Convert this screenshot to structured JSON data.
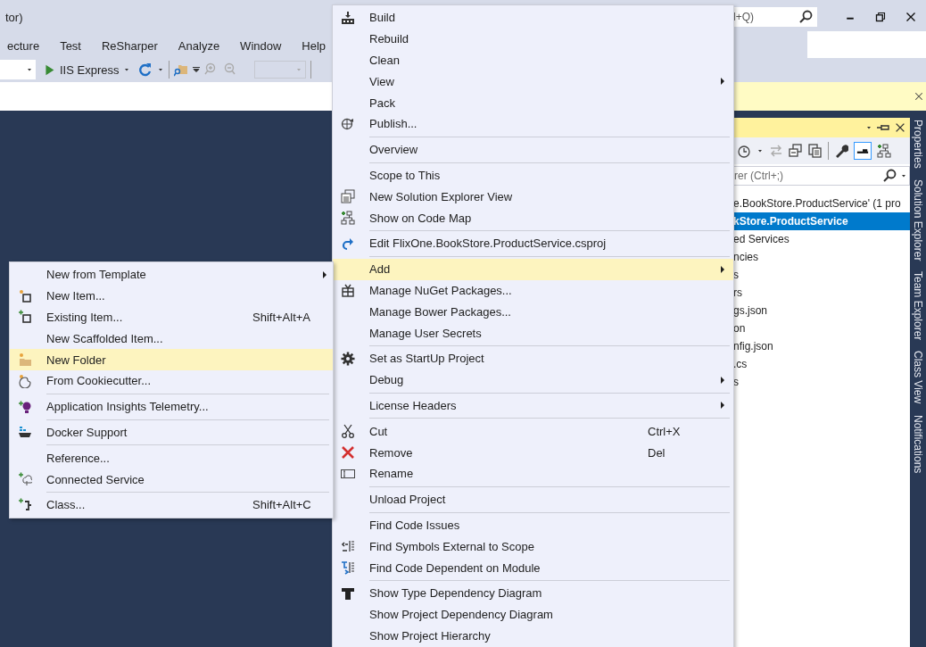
{
  "title_bar": {
    "title": "tor)",
    "search": {
      "placeholder": "l+Q)"
    }
  },
  "menu_bar": [
    "ecture",
    "Test",
    "ReSharper",
    "Analyze",
    "Window",
    "Help"
  ],
  "toolbar": {
    "launch": "IIS Express"
  },
  "solution_explorer": {
    "search": {
      "placeholder": "rer (Ctrl+;)"
    },
    "tree": [
      {
        "label": "e.BookStore.ProductService' (1 pro",
        "selected": false
      },
      {
        "label": "kStore.ProductService",
        "selected": true
      },
      {
        "label": "ed Services",
        "selected": false
      },
      {
        "label": "ncies",
        "selected": false
      },
      {
        "label": "s",
        "selected": false
      },
      {
        "label": "rs",
        "selected": false
      },
      {
        "label": "gs.json",
        "selected": false
      },
      {
        "label": "on",
        "selected": false
      },
      {
        "label": "nfig.json",
        "selected": false
      },
      {
        "label": ".cs",
        "selected": false
      },
      {
        "label": "s",
        "selected": false
      }
    ]
  },
  "side_tabs": [
    "Properties",
    "Solution Explorer",
    "Team Explorer",
    "Class View",
    "Notifications"
  ],
  "context_menu": {
    "items": [
      {
        "kind": "item",
        "label": "Build",
        "submenu": false,
        "selected": false
      },
      {
        "kind": "item",
        "label": "Rebuild",
        "submenu": false,
        "selected": false
      },
      {
        "kind": "item",
        "label": "Clean",
        "submenu": false,
        "selected": false
      },
      {
        "kind": "item",
        "label": "View",
        "submenu": true,
        "selected": false
      },
      {
        "kind": "item",
        "label": "Pack",
        "submenu": false,
        "selected": false
      },
      {
        "kind": "item",
        "label": "Publish...",
        "submenu": false,
        "selected": false
      },
      {
        "kind": "separator"
      },
      {
        "kind": "item",
        "label": "Overview",
        "submenu": false,
        "selected": false
      },
      {
        "kind": "separator"
      },
      {
        "kind": "item",
        "label": "Scope to This",
        "submenu": false,
        "selected": false
      },
      {
        "kind": "item",
        "label": "New Solution Explorer View",
        "submenu": false,
        "selected": false
      },
      {
        "kind": "item",
        "label": "Show on Code Map",
        "submenu": false,
        "selected": false
      },
      {
        "kind": "separator"
      },
      {
        "kind": "item",
        "label": "Edit FlixOne.BookStore.ProductService.csproj",
        "submenu": false,
        "selected": false
      },
      {
        "kind": "separator"
      },
      {
        "kind": "item",
        "label": "Add",
        "submenu": true,
        "selected": true
      },
      {
        "kind": "item",
        "label": "Manage NuGet Packages...",
        "submenu": false,
        "selected": false
      },
      {
        "kind": "item",
        "label": "Manage Bower Packages...",
        "submenu": false,
        "selected": false
      },
      {
        "kind": "item",
        "label": "Manage User Secrets",
        "submenu": false,
        "selected": false
      },
      {
        "kind": "separator"
      },
      {
        "kind": "item",
        "label": "Set as StartUp Project",
        "submenu": false,
        "selected": false
      },
      {
        "kind": "item",
        "label": "Debug",
        "submenu": true,
        "selected": false
      },
      {
        "kind": "separator"
      },
      {
        "kind": "item",
        "label": "License Headers",
        "submenu": true,
        "selected": false
      },
      {
        "kind": "separator"
      },
      {
        "kind": "item",
        "label": "Cut",
        "shortcut": "Ctrl+X",
        "submenu": false,
        "selected": false
      },
      {
        "kind": "item",
        "label": "Remove",
        "shortcut": "Del",
        "submenu": false,
        "selected": false
      },
      {
        "kind": "item",
        "label": "Rename",
        "submenu": false,
        "selected": false
      },
      {
        "kind": "separator"
      },
      {
        "kind": "item",
        "label": "Unload Project",
        "submenu": false,
        "selected": false
      },
      {
        "kind": "separator"
      },
      {
        "kind": "item",
        "label": "Find Code Issues",
        "submenu": false,
        "selected": false
      },
      {
        "kind": "item",
        "label": "Find Symbols External to Scope",
        "submenu": false,
        "selected": false
      },
      {
        "kind": "item",
        "label": "Find Code Dependent on Module",
        "submenu": false,
        "selected": false
      },
      {
        "kind": "separator"
      },
      {
        "kind": "item",
        "label": "Show Type Dependency Diagram",
        "submenu": false,
        "selected": false
      },
      {
        "kind": "item",
        "label": "Show Project Dependency Diagram",
        "submenu": false,
        "selected": false
      },
      {
        "kind": "item",
        "label": "Show Project Hierarchy",
        "submenu": false,
        "selected": false
      }
    ]
  },
  "add_submenu": {
    "items": [
      {
        "kind": "item",
        "label": "New from Template",
        "submenu": true,
        "selected": false
      },
      {
        "kind": "item",
        "label": "New Item...",
        "submenu": false,
        "selected": false
      },
      {
        "kind": "item",
        "label": "Existing Item...",
        "shortcut": "Shift+Alt+A",
        "submenu": false,
        "selected": false
      },
      {
        "kind": "item",
        "label": "New Scaffolded Item...",
        "submenu": false,
        "selected": false
      },
      {
        "kind": "item",
        "label": "New Folder",
        "submenu": false,
        "selected": true
      },
      {
        "kind": "item",
        "label": "From Cookiecutter...",
        "submenu": false,
        "selected": false
      },
      {
        "kind": "separator"
      },
      {
        "kind": "item",
        "label": "Application Insights Telemetry...",
        "submenu": false,
        "selected": false
      },
      {
        "kind": "separator"
      },
      {
        "kind": "item",
        "label": "Docker Support",
        "submenu": false,
        "selected": false
      },
      {
        "kind": "separator"
      },
      {
        "kind": "item",
        "label": "Reference...",
        "submenu": false,
        "selected": false
      },
      {
        "kind": "item",
        "label": "Connected Service",
        "submenu": false,
        "selected": false
      },
      {
        "kind": "separator"
      },
      {
        "kind": "item",
        "label": "Class...",
        "shortcut": "Shift+Alt+C",
        "submenu": false,
        "selected": false
      }
    ]
  }
}
